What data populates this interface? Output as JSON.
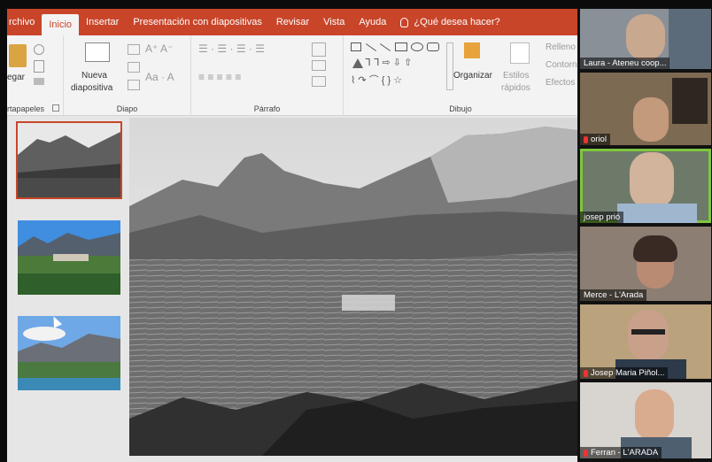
{
  "ribbon_tabs": [
    "rchivo",
    "Inicio",
    "Insertar",
    "Presentación con diapositivas",
    "Revisar",
    "Vista",
    "Ayuda"
  ],
  "tell_me": "¿Qué desea hacer?",
  "clipboard": {
    "paste": "egar",
    "label": "rtapapeles"
  },
  "slides_group": {
    "new_slide_line1": "Nueva",
    "new_slide_line2": "diapositiva",
    "label": "Diapo"
  },
  "paragraph_label": "Párrafo",
  "drawing": {
    "arrange": "Organizar",
    "quick_styles_line1": "Estilos",
    "quick_styles_line2": "rápidos",
    "label": "Dibujo",
    "fill": "Relleno",
    "outline": "Contorno",
    "effects": "Efectos"
  },
  "participants": [
    {
      "name": "Laura - Ateneu coop...",
      "muted": false
    },
    {
      "name": "oriol",
      "muted": true
    },
    {
      "name": "josep prió",
      "muted": false
    },
    {
      "name": "Merce - L'Arada",
      "muted": false
    },
    {
      "name": "Josep Maria Piñol...",
      "muted": true
    },
    {
      "name": "Ferran - L'ARADA",
      "muted": true
    }
  ],
  "colors": {
    "accent": "#c8452a",
    "speaking": "#7ec63c"
  }
}
